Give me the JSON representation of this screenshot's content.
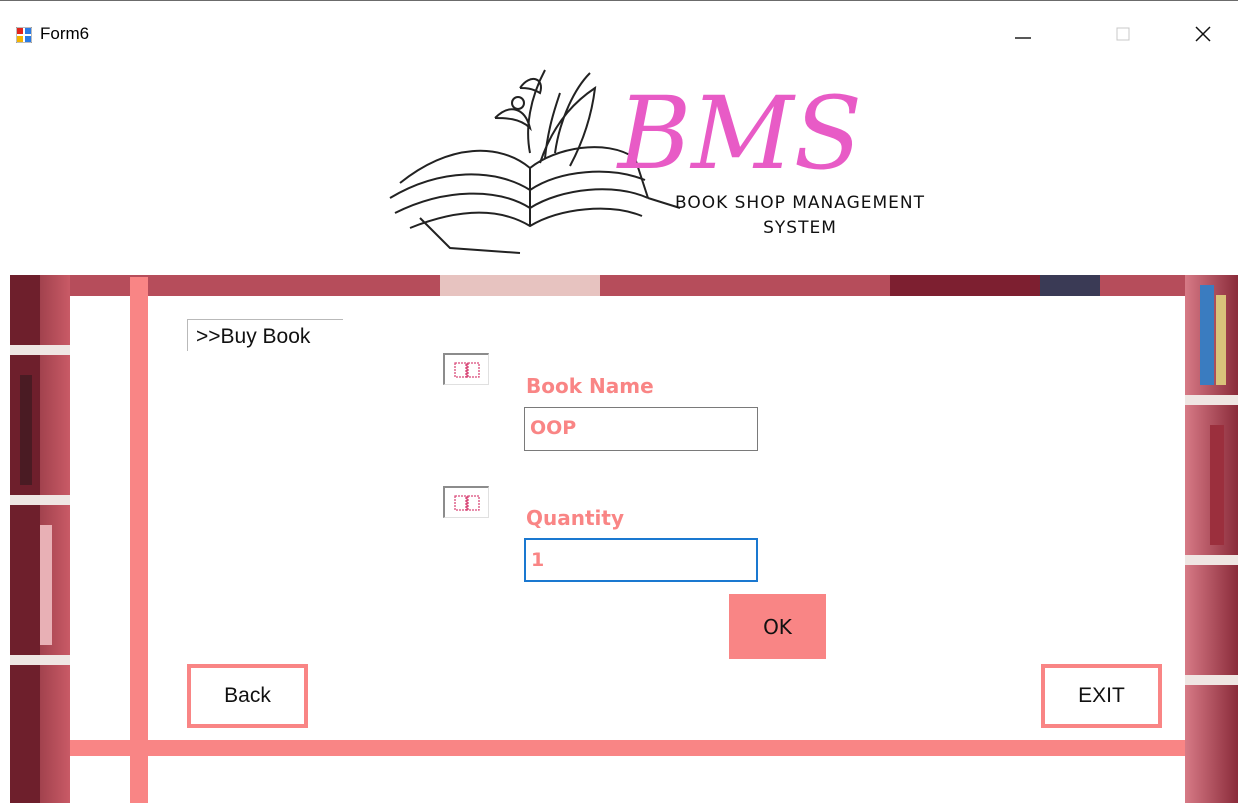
{
  "window": {
    "title": "Form6",
    "minimize_glyph": "—",
    "close_glyph": "✕"
  },
  "logo": {
    "brand": "BMS",
    "tagline_line1": "BOOK SHOP MANAGEMENT",
    "tagline_line2": "SYSTEM",
    "brand_color": "#e85bc6"
  },
  "breadcrumb": ">>Buy Book",
  "form": {
    "book_name_label": "Book Name",
    "book_name_value": "OOP",
    "quantity_label": "Quantity",
    "quantity_value": "1",
    "ok_label": "OK"
  },
  "nav": {
    "back_label": "Back",
    "exit_label": "EXIT"
  },
  "colors": {
    "accent": "#f98585",
    "brand_pink": "#e85bc6",
    "focus_border": "#1a78d0"
  },
  "icons": {
    "field_icon": "book-icon",
    "app_icon": "windows-form-icon"
  }
}
